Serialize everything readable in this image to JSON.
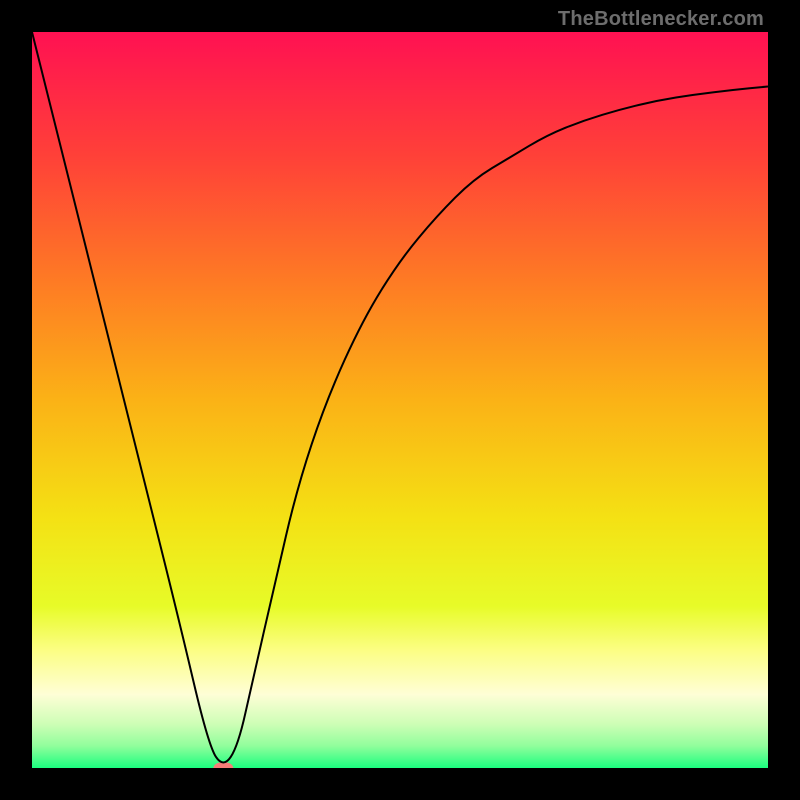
{
  "watermark": "TheBottlenecker.com",
  "chart_data": {
    "type": "line",
    "title": "",
    "xlabel": "",
    "ylabel": "",
    "xlim": [
      0,
      100
    ],
    "ylim": [
      0,
      100
    ],
    "grid": false,
    "background": {
      "type": "vertical-gradient",
      "stops": [
        {
          "offset": 0.0,
          "color": "#ff1152"
        },
        {
          "offset": 0.17,
          "color": "#ff4138"
        },
        {
          "offset": 0.34,
          "color": "#fe7b24"
        },
        {
          "offset": 0.5,
          "color": "#fbb216"
        },
        {
          "offset": 0.66,
          "color": "#f4e114"
        },
        {
          "offset": 0.78,
          "color": "#e7fb28"
        },
        {
          "offset": 0.84,
          "color": "#fcfe84"
        },
        {
          "offset": 0.9,
          "color": "#fefed6"
        },
        {
          "offset": 0.94,
          "color": "#cefeb6"
        },
        {
          "offset": 0.97,
          "color": "#91fe9c"
        },
        {
          "offset": 1.0,
          "color": "#1bfe7f"
        }
      ]
    },
    "series": [
      {
        "name": "curve",
        "color": "#000000",
        "x": [
          0,
          5,
          10,
          15,
          20,
          24,
          26,
          28,
          30,
          33,
          36,
          40,
          45,
          50,
          55,
          60,
          65,
          70,
          75,
          80,
          85,
          90,
          95,
          100
        ],
        "y": [
          100,
          80,
          60,
          40,
          20,
          3,
          0,
          3,
          12,
          25,
          38,
          50,
          61,
          69,
          75,
          80,
          83,
          86,
          88,
          89.5,
          90.7,
          91.5,
          92.1,
          92.6
        ]
      }
    ],
    "marker": {
      "name": "minimum-marker",
      "x": 26,
      "y": 0,
      "color": "#f77d78",
      "rx": 10,
      "ry": 6
    }
  }
}
